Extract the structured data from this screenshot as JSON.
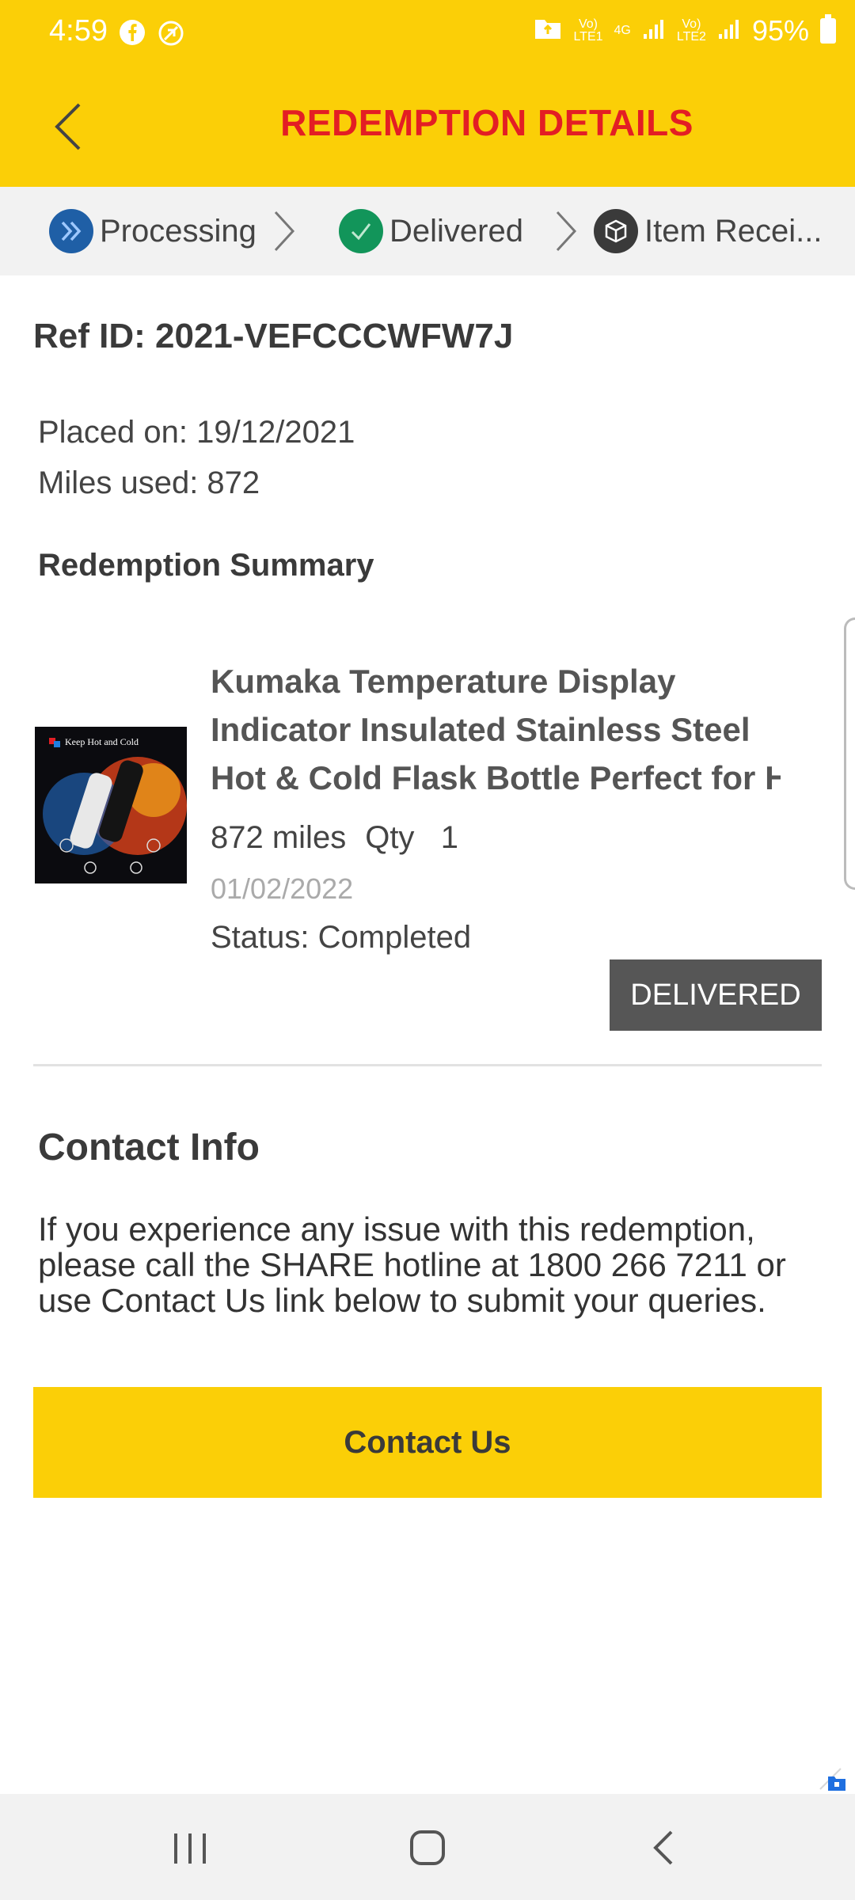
{
  "status_bar": {
    "time": "4:59",
    "net1_top": "Vo)",
    "net1_bottom": "LTE1",
    "net_type": "4G",
    "net2_top": "Vo)",
    "net2_bottom": "LTE2",
    "battery": "95%"
  },
  "header": {
    "title": "REDEMPTION DETAILS",
    "back_icon": "chevron-left-icon"
  },
  "steps": [
    {
      "label": "Processing",
      "icon": "double-chevron-icon",
      "color": "#1f5fa6"
    },
    {
      "label": "Delivered",
      "icon": "check-icon",
      "color": "#12955a"
    },
    {
      "label": "Item Recei...",
      "icon": "box-icon",
      "color": "#3a3a3a"
    }
  ],
  "order": {
    "ref_id": "Ref ID: 2021-VEFCCCWFW7J",
    "placed_on": "Placed on: 19/12/2021",
    "miles_used": "Miles used: 872",
    "summary_title": "Redemption Summary"
  },
  "item": {
    "name_lines": [
      "Kumaka Temperature Display",
      "Indicator Insulated Stainless Steel",
      "Hot & Cold Flask Bottle Perfect for H"
    ],
    "image_text": "Keep Hot and Cold",
    "miles": "872 miles",
    "qty": "Qty   1",
    "date": "01/02/2022",
    "status": "Status: Completed",
    "badge": "DELIVERED"
  },
  "contact": {
    "title": "Contact Info",
    "text": "If you experience any issue with this redemption, please call the SHARE hotline at 1800 266 7211 or use Contact Us link below to submit your queries.",
    "button_label": "Contact Us"
  },
  "colors": {
    "brand_yellow": "#fbcf07",
    "title_red": "#e31e24",
    "badge_gray": "#565656"
  }
}
